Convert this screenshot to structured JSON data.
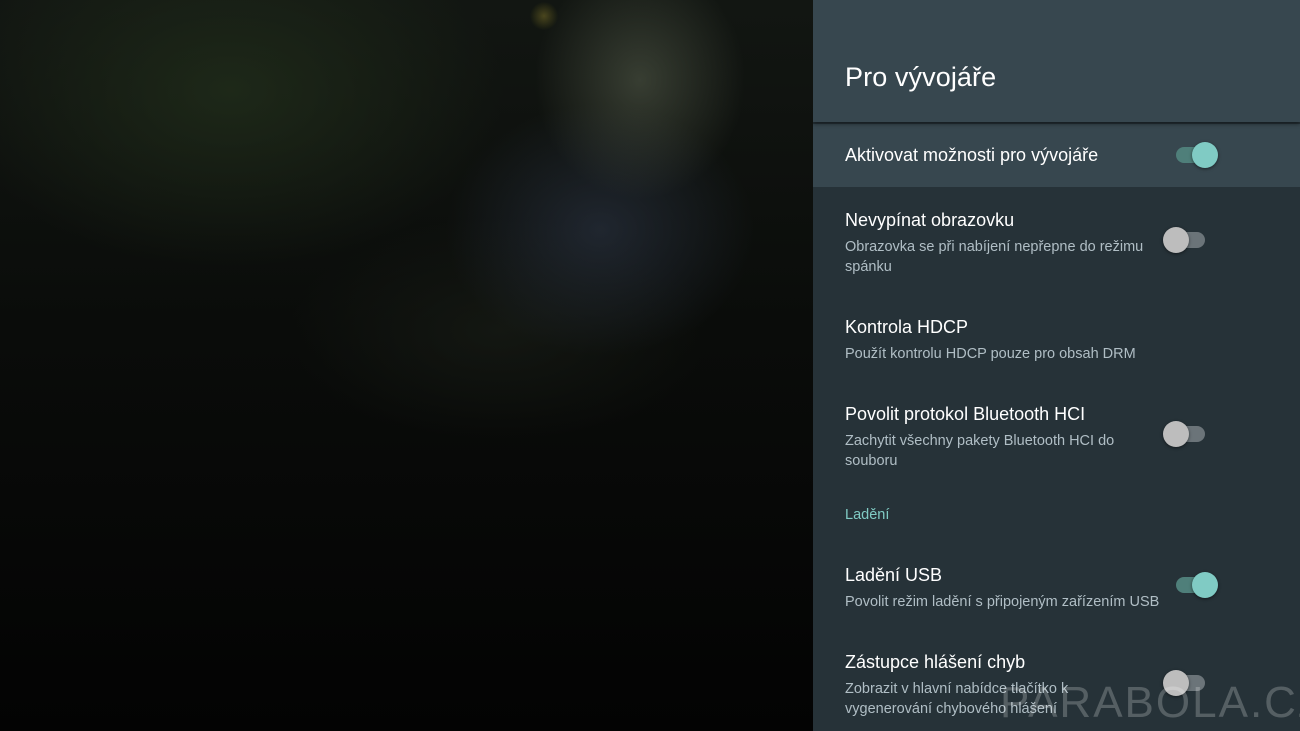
{
  "header": {
    "title": "Pro vývojáře"
  },
  "settings": {
    "developer_options": {
      "title": "Aktivovat možnosti pro vývojáře",
      "enabled": true
    },
    "stay_awake": {
      "title": "Nevypínat obrazovku",
      "subtitle": "Obrazovka se při nabíjení nepřepne do režimu spánku",
      "enabled": false
    },
    "hdcp": {
      "title": "Kontrola HDCP",
      "subtitle": "Použít kontrolu HDCP pouze pro obsah DRM"
    },
    "bt_hci": {
      "title": "Povolit protokol Bluetooth HCI",
      "subtitle": "Zachytit všechny pakety Bluetooth HCI do souboru",
      "enabled": false
    },
    "debug_section": {
      "label": "Ladění"
    },
    "usb_debug": {
      "title": "Ladění USB",
      "subtitle": "Povolit režim ladění s připojeným zařízením USB",
      "enabled": true
    },
    "bug_report": {
      "title": "Zástupce hlášení chyb",
      "subtitle": "Zobrazit v hlavní nabídce tlačítko k vygenerování chybového hlášení",
      "enabled": false
    }
  },
  "watermark": "PARABOLA.CZ",
  "colors": {
    "accent": "#80cbc4",
    "panel": "#263238",
    "header": "#37474f"
  }
}
